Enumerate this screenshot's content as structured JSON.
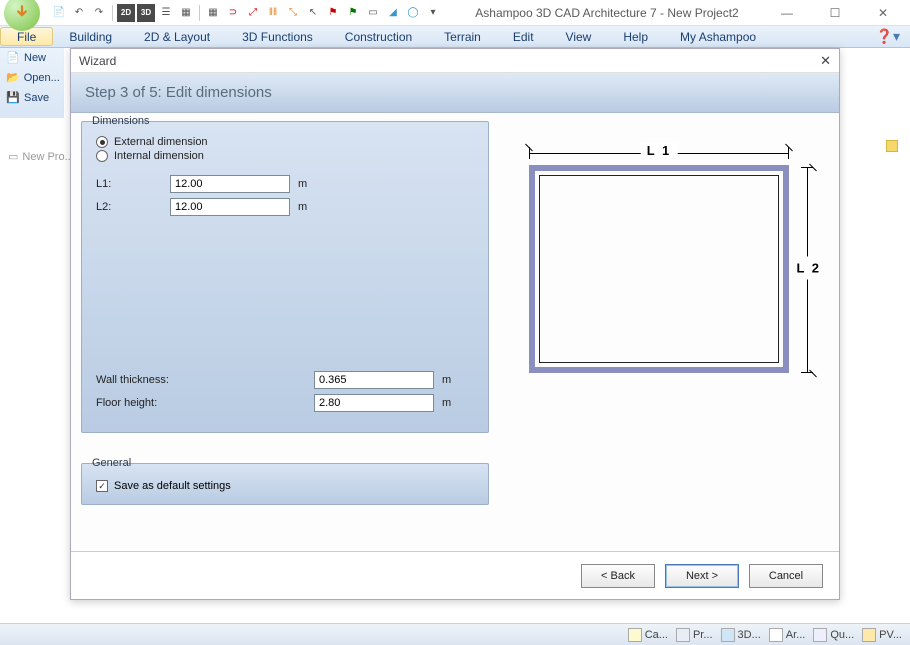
{
  "app": {
    "title": "Ashampoo 3D CAD Architecture 7 - New Project2"
  },
  "menu": {
    "file": "File",
    "building": "Building",
    "layout2d": "2D & Layout",
    "functions3d": "3D Functions",
    "construction": "Construction",
    "terrain": "Terrain",
    "edit": "Edit",
    "view": "View",
    "help": "Help",
    "my": "My Ashampoo"
  },
  "side": {
    "new": "New",
    "open": "Open...",
    "save": "Save"
  },
  "bg": {
    "newpro": "New Pro..."
  },
  "wizard": {
    "title": "Wizard",
    "step_header": "Step 3 of 5:   Edit dimensions",
    "dimensions": {
      "legend": "Dimensions",
      "external": "External dimension",
      "internal": "Internal dimension",
      "l1_label": "L1:",
      "l1_value": "12.00",
      "l2_label": "L2:",
      "l2_value": "12.00",
      "unit": "m",
      "wall_label": "Wall thickness:",
      "wall_value": "0.365",
      "floor_label": "Floor height:",
      "floor_value": "2.80"
    },
    "preview": {
      "l1": "L 1",
      "l2": "L 2"
    },
    "general": {
      "legend": "General",
      "save_default": "Save as default settings"
    },
    "buttons": {
      "back": "< Back",
      "next": "Next >",
      "cancel": "Cancel"
    }
  },
  "status": {
    "ca": "Ca...",
    "pr": "Pr...",
    "d3": "3D...",
    "ar": "Ar...",
    "qu": "Qu...",
    "pv": "PV..."
  }
}
